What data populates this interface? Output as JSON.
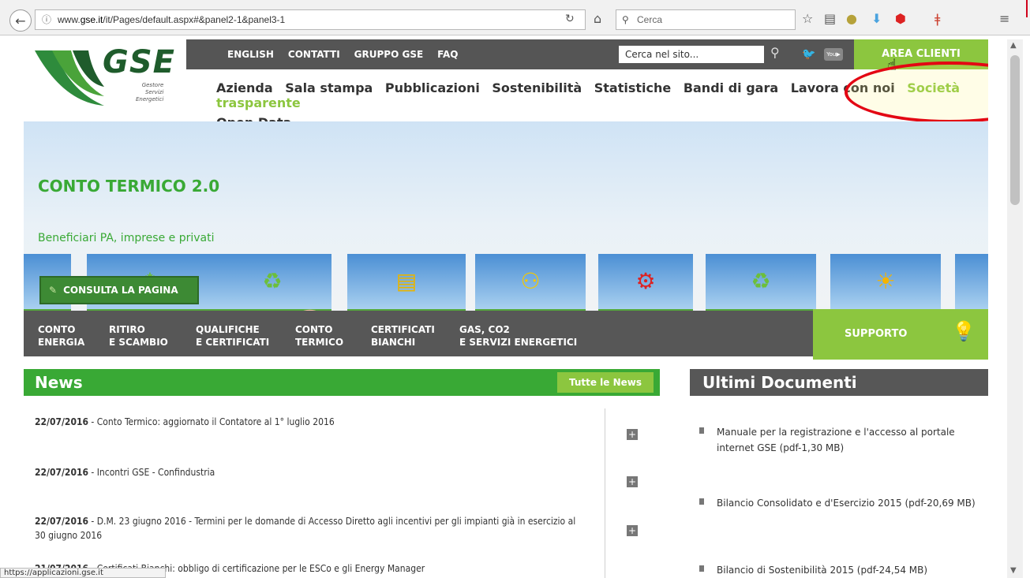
{
  "browser": {
    "url_prefix": "www.",
    "url_domain": "gse.it",
    "url_rest": "/it/Pages/default.aspx#&panel2-1&panel3-1",
    "search_placeholder": "Cerca",
    "status_text": "https://applicazioni.gse.it"
  },
  "header": {
    "logo_text": "GSE",
    "logo_sub_1": "Gestore",
    "logo_sub_2": "Servizi",
    "logo_sub_3": "Energetici",
    "top_links": [
      "ENGLISH",
      "CONTATTI",
      "GRUPPO GSE",
      "FAQ"
    ],
    "site_search_placeholder": "Cerca nel sito...",
    "area_clienti": "AREA CLIENTI",
    "main_nav": [
      "Azienda",
      "Sala stampa",
      "Pubblicazioni",
      "Sostenibilità",
      "Statistiche",
      "Bandi di gara",
      "Lavora con noi",
      "Società trasparente"
    ],
    "main_nav_second": "Open Data"
  },
  "hero": {
    "title": "CONTO TERMICO 2.0",
    "subtitle": "Beneficiari PA, imprese e privati",
    "cta": "CONSULTA LA PAGINA"
  },
  "services": [
    {
      "line1": "CONTO",
      "line2": "ENERGIA"
    },
    {
      "line1": "RITIRO",
      "line2": "E SCAMBIO"
    },
    {
      "line1": "QUALIFICHE",
      "line2": "E CERTIFICATI"
    },
    {
      "line1": "CONTO",
      "line2": "TERMICO"
    },
    {
      "line1": "CERTIFICATI",
      "line2": "BIANCHI"
    },
    {
      "line1": "GAS, CO2",
      "line2": "E SERVIZI ENERGETICI"
    }
  ],
  "supporto": "SUPPORTO",
  "news": {
    "title": "News",
    "all_link": "Tutte le News",
    "items": [
      {
        "date": "22/07/2016",
        "text": " - Conto Termico: aggiornato il Contatore al 1° luglio 2016"
      },
      {
        "date": "22/07/2016",
        "text": " - Incontri GSE - Confindustria"
      },
      {
        "date": "22/07/2016",
        "text": " - D.M. 23 giugno 2016 - Termini per le domande di Accesso Diretto agli incentivi per gli impianti già in esercizio al 30 giugno 2016"
      },
      {
        "date": "21/07/2016",
        "text": " - Certificati Bianchi: obbligo di certificazione per le ESCo e gli Energy Manager"
      }
    ]
  },
  "docs": {
    "title": "Ultimi Documenti",
    "items": [
      "Manuale per la registrazione e l'accesso al portale internet GSE (pdf-1,30 MB)",
      "Bilancio Consolidato e d'Esercizio 2015 (pdf-20,69 MB)",
      "Bilancio di Sostenibilità 2015 (pdf-24,54 MB)"
    ]
  }
}
